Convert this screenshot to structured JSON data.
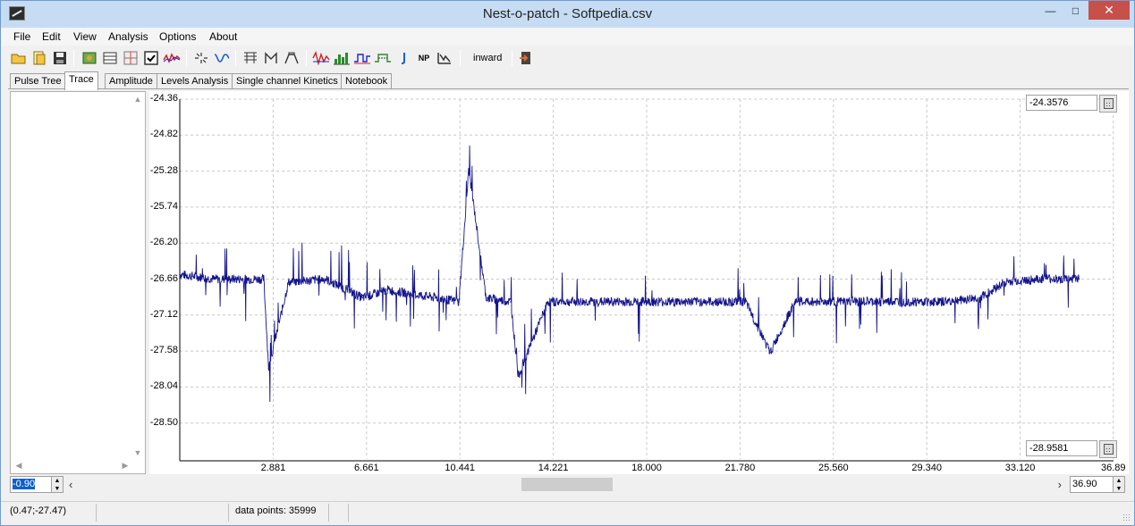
{
  "window": {
    "title": "Nest-o-patch - Softpedia.csv",
    "min_glyph": "—",
    "max_glyph": "□",
    "close_glyph": "✕"
  },
  "menu": [
    "File",
    "Edit",
    "View",
    "Analysis",
    "Options",
    "About"
  ],
  "toolbar": {
    "icons": [
      "open-folder-icon",
      "new-document-icon",
      "save-icon",
      "tree-icon",
      "table-icon",
      "grid-icon",
      "check-icon",
      "trace-multi-icon",
      "idealize-icon",
      "fit-icon",
      "levels-icon",
      "bracket-icon",
      "bracket-alt-icon",
      "trace-red-icon",
      "histogram-icon",
      "kinetics-blue-icon",
      "kinetics-green-icon",
      "info-icon",
      "np-icon",
      "filter-icon",
      "exit-icon"
    ],
    "direction_label": "inward",
    "np_label": "NP"
  },
  "tabs": [
    "Pulse Tree",
    "Trace",
    "Amplitude",
    "Levels Analysis",
    "Single channel Kinetics",
    "Notebook"
  ],
  "active_tab": "Trace",
  "trace": {
    "y_max_value": "-24.3576",
    "y_min_value": "-28.9581",
    "x_start_value": "-0.90",
    "x_end_value": "36.90"
  },
  "status": {
    "cursor": "(0.47;-27.47)",
    "data_points": "data points: 35999"
  },
  "colors": {
    "trace": "#14148c",
    "grid": "#c8c8c8"
  },
  "chart_data": {
    "type": "line",
    "series": [
      {
        "x": [
          -0.9,
          0.5,
          2.5,
          2.7,
          3.5,
          5.0,
          6.5,
          7.5,
          9.5,
          10.4,
          10.8,
          11.5,
          12.5,
          12.8,
          14.0,
          16.0,
          18.0,
          20.0,
          22.0,
          23.0,
          24.0,
          26.0,
          28.0,
          30.0,
          31.5,
          32.5,
          34.0,
          35.5
        ],
        "y": [
          -26.6,
          -26.66,
          -26.66,
          -27.8,
          -26.7,
          -26.66,
          -26.9,
          -26.8,
          -26.9,
          -26.95,
          -25.25,
          -26.9,
          -26.95,
          -27.9,
          -26.95,
          -26.95,
          -26.95,
          -26.95,
          -26.95,
          -27.6,
          -26.95,
          -26.95,
          -26.95,
          -26.95,
          -26.9,
          -26.7,
          -26.66,
          -26.66
        ]
      }
    ],
    "xticks": [
      "2.881",
      "6.661",
      "10.441",
      "14.221",
      "18.000",
      "21.780",
      "25.560",
      "29.340",
      "33.120",
      "36.89"
    ],
    "yticks": [
      "-24.36",
      "-24.82",
      "-25.28",
      "-25.74",
      "-26.20",
      "-26.66",
      "-27.12",
      "-27.58",
      "-28.04",
      "-28.50"
    ],
    "xlim": [
      -0.9,
      36.9
    ],
    "ylim": [
      -28.96,
      -24.36
    ],
    "grid": true
  }
}
